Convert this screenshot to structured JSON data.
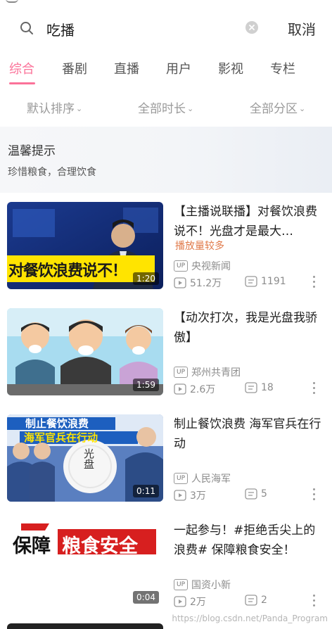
{
  "search": {
    "query": "吃播",
    "cancel_label": "取消"
  },
  "tabs": [
    {
      "label": "综合",
      "active": true
    },
    {
      "label": "番剧"
    },
    {
      "label": "直播"
    },
    {
      "label": "用户"
    },
    {
      "label": "影视"
    },
    {
      "label": "专栏"
    }
  ],
  "filters": [
    {
      "label": "默认排序"
    },
    {
      "label": "全部时长"
    },
    {
      "label": "全部分区"
    }
  ],
  "tip": {
    "title": "温馨提示",
    "subtitle": "珍惜粮食，合理饮食"
  },
  "videos": [
    {
      "title": "【主播说联播】对餐饮浪费说不！光盘才是最大…",
      "badge": "播放量较多",
      "uploader": "央视新闻",
      "views": "51.2万",
      "comments": "1191",
      "duration": "1:20",
      "thumb_text": "对餐饮浪费说不！"
    },
    {
      "title": "【动次打次，我是光盘我骄傲】",
      "uploader": "郑州共青团",
      "views": "2.6万",
      "comments": "18",
      "duration": "1:59"
    },
    {
      "title": "制止餐饮浪费 海军官兵在行动",
      "uploader": "人民海军",
      "views": "3万",
      "comments": "5",
      "duration": "0:11",
      "thumb_text1": "制止餐饮浪费",
      "thumb_text2": "海军官兵在行动",
      "thumb_plate": "光盘"
    },
    {
      "title": "一起参与！#拒绝舌尖上的浪费# 保障粮食安全！",
      "uploader": "国资小新",
      "views": "2万",
      "comments": "2",
      "duration": "0:04",
      "thumb_text1": "保障",
      "thumb_text2": "粮食安全"
    }
  ],
  "up_tag": "UP",
  "watermark": "https://blog.csdn.net/Panda_Program",
  "colors": {
    "accent": "#fb7299",
    "badge": "#e07a4a",
    "muted": "#8c8c8c"
  }
}
